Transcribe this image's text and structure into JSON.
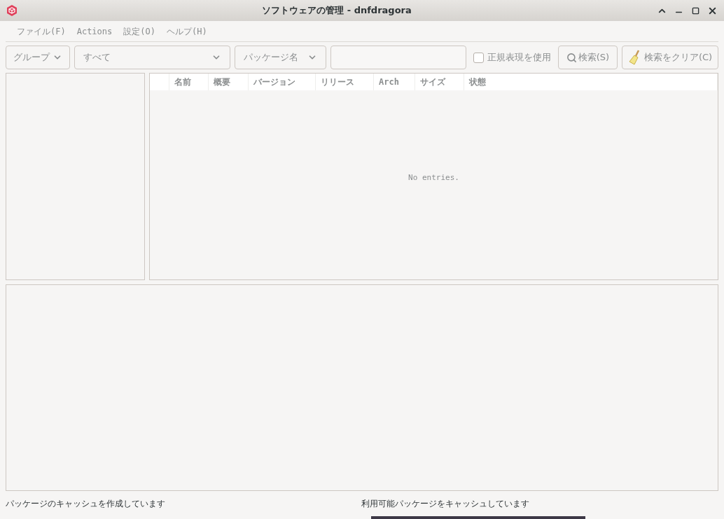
{
  "window": {
    "title": "ソフトウェアの管理 - dnfdragora"
  },
  "menu": [
    "ファイル(F)",
    "Actions",
    "設定(O)",
    "ヘルプ(H)"
  ],
  "toolbar": {
    "group_select": "グループ",
    "filter_select": "すべて",
    "field_select": "パッケージ名",
    "regex": {
      "label": "正規表現を使用",
      "checked": false
    },
    "search_button": "検索(S)",
    "clear_button": "検索をクリア(C)"
  },
  "table": {
    "columns": [
      "名前",
      "概要",
      "バージョン",
      "リリース",
      "Arch",
      "サイズ",
      "状態"
    ],
    "empty_text": "No entries."
  },
  "status_bar": {
    "left": "パッケージのキャッシュを作成しています",
    "right": "利用可能パッケージをキャッシュしています",
    "progress": {
      "level": 1
    }
  }
}
